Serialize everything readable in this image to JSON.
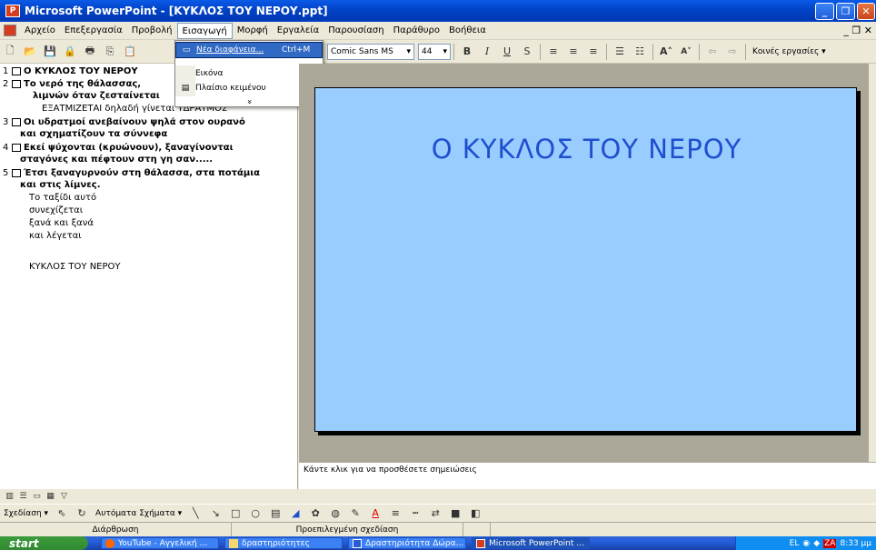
{
  "window": {
    "title": "Microsoft PowerPoint - [ΚΥΚΛΟΣ ΤΟΥ ΝΕΡΟΥ.ppt]"
  },
  "menubar": {
    "items": [
      "Αρχείο",
      "Επεξεργασία",
      "Προβολή",
      "Εισαγωγή",
      "Μορφή",
      "Εργαλεία",
      "Παρουσίαση",
      "Παράθυρο",
      "Βοήθεια"
    ],
    "active": "Εισαγωγή"
  },
  "toolbar": {
    "font_name": "Comic Sans MS",
    "font_size": "44",
    "task_pane": "Κοινές εργασίες"
  },
  "insert_menu": {
    "items": [
      {
        "label": "Νέα διαφάνεια...",
        "shortcut": "Ctrl+M"
      },
      {
        "label": "Εικόνα",
        "shortcut": "▸"
      },
      {
        "label": "Πλαίσιο κειμένου",
        "shortcut": ""
      }
    ],
    "expand": "»"
  },
  "outline": {
    "slides": [
      {
        "num": "1",
        "text": "Ο ΚΥΚΛΟΣ ΤΟΥ ΝΕΡΟΥ"
      },
      {
        "num": "2",
        "text": "Το νερό της θάλασσας, "
      },
      {
        "num": "",
        "text": "λιμνών όταν ζεσταίνεται"
      },
      {
        "num": "3",
        "text": "Οι υδρατμοί ανεβαίνουν ψηλά στον ουρανό"
      },
      {
        "num": "",
        "text": "και σχηματίζουν τα σύννεφα"
      },
      {
        "num": "4",
        "text": "Εκεί ψύχονται (κρυώνουν), ξαναγίνονται"
      },
      {
        "num": "",
        "text": "σταγόνες και πέφτουν στη γη σαν....."
      },
      {
        "num": "5",
        "text": "Έτσι ξαναγυρνούν στη θάλασσα, στα ποτάμια"
      },
      {
        "num": "",
        "text": "και στις λίμνες."
      }
    ],
    "sub_lines": [
      "ΕΞΑΤΜΙΖΕΤΑΙ δηλαδή γίνεται ΥΔΡΑΤΜΟΣ",
      "Το ταξίδι αυτό",
      "συνεχίζεται",
      "ξανά και ξανά",
      "και λέγεται",
      "ΚΥΚΛΟΣ ΤΟΥ ΝΕΡΟΥ"
    ]
  },
  "slide": {
    "title": "Ο ΚΥΚΛΟΣ ΤΟΥ ΝΕΡΟΥ",
    "background": "#99ccff",
    "title_color": "#1f4fcf"
  },
  "notes": {
    "placeholder": "Κάντε κλικ για να προσθέσετε σημειώσεις"
  },
  "drawbar": {
    "draw": "Σχεδίαση ▾",
    "autoshapes": "Αυτόματα Σχήματα ▾"
  },
  "statusbar": {
    "left": "Διάρθρωση",
    "middle": "Προεπιλεγμένη σχεδίαση"
  },
  "taskbar": {
    "start": "start",
    "tasks": [
      "YouTube - Αγγελική ...",
      "δραστηριότητες",
      "Δραστηριότητα Δώρα...",
      "Microsoft PowerPoint ..."
    ],
    "lang": "EL",
    "clock": "8:33 μμ"
  }
}
